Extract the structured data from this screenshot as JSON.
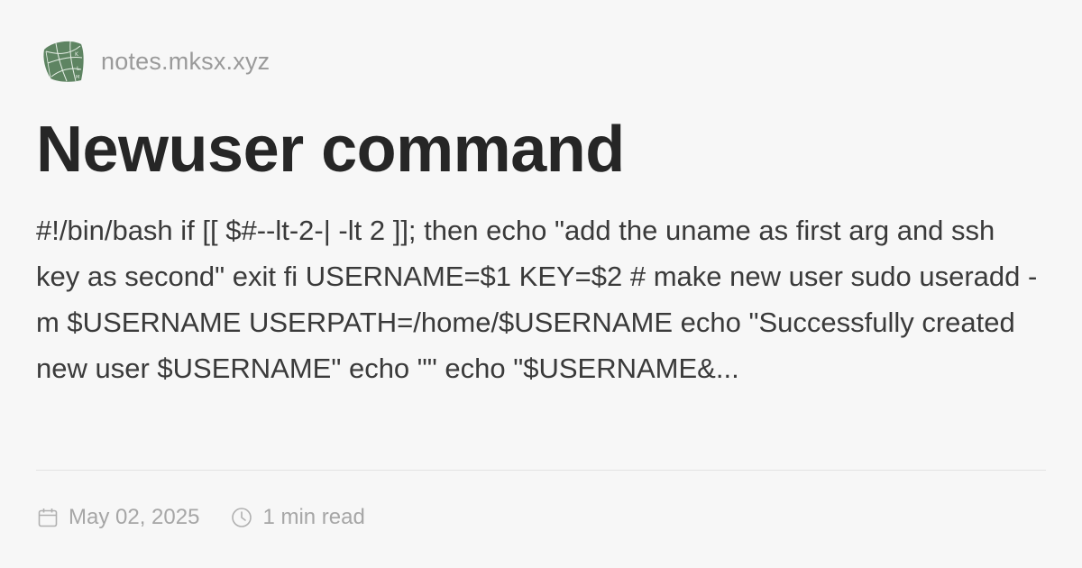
{
  "site": {
    "name": "notes.mksx.xyz",
    "logo_icon": "leaf-logo-icon",
    "logo_color": "#5e8462"
  },
  "post": {
    "title": "Newuser command",
    "excerpt": "#!/bin/bash if [[ $#--lt-2-| -lt 2 ]]; then echo \"add the uname as first arg and ssh key as second\" exit fi USERNAME=$1 KEY=$2 # make new user sudo useradd -m $USERNAME USERPATH=/home/$USERNAME echo \"Successfully created new user $USERNAME\" echo \"\" echo \"$USERNAME&...",
    "date": "May 02, 2025",
    "read_time": "1 min read",
    "date_icon": "calendar-icon",
    "read_time_icon": "clock-icon"
  },
  "colors": {
    "background": "#f7f7f7",
    "title": "#262626",
    "body_text": "#3a3a3a",
    "muted": "#a6a6a6"
  }
}
